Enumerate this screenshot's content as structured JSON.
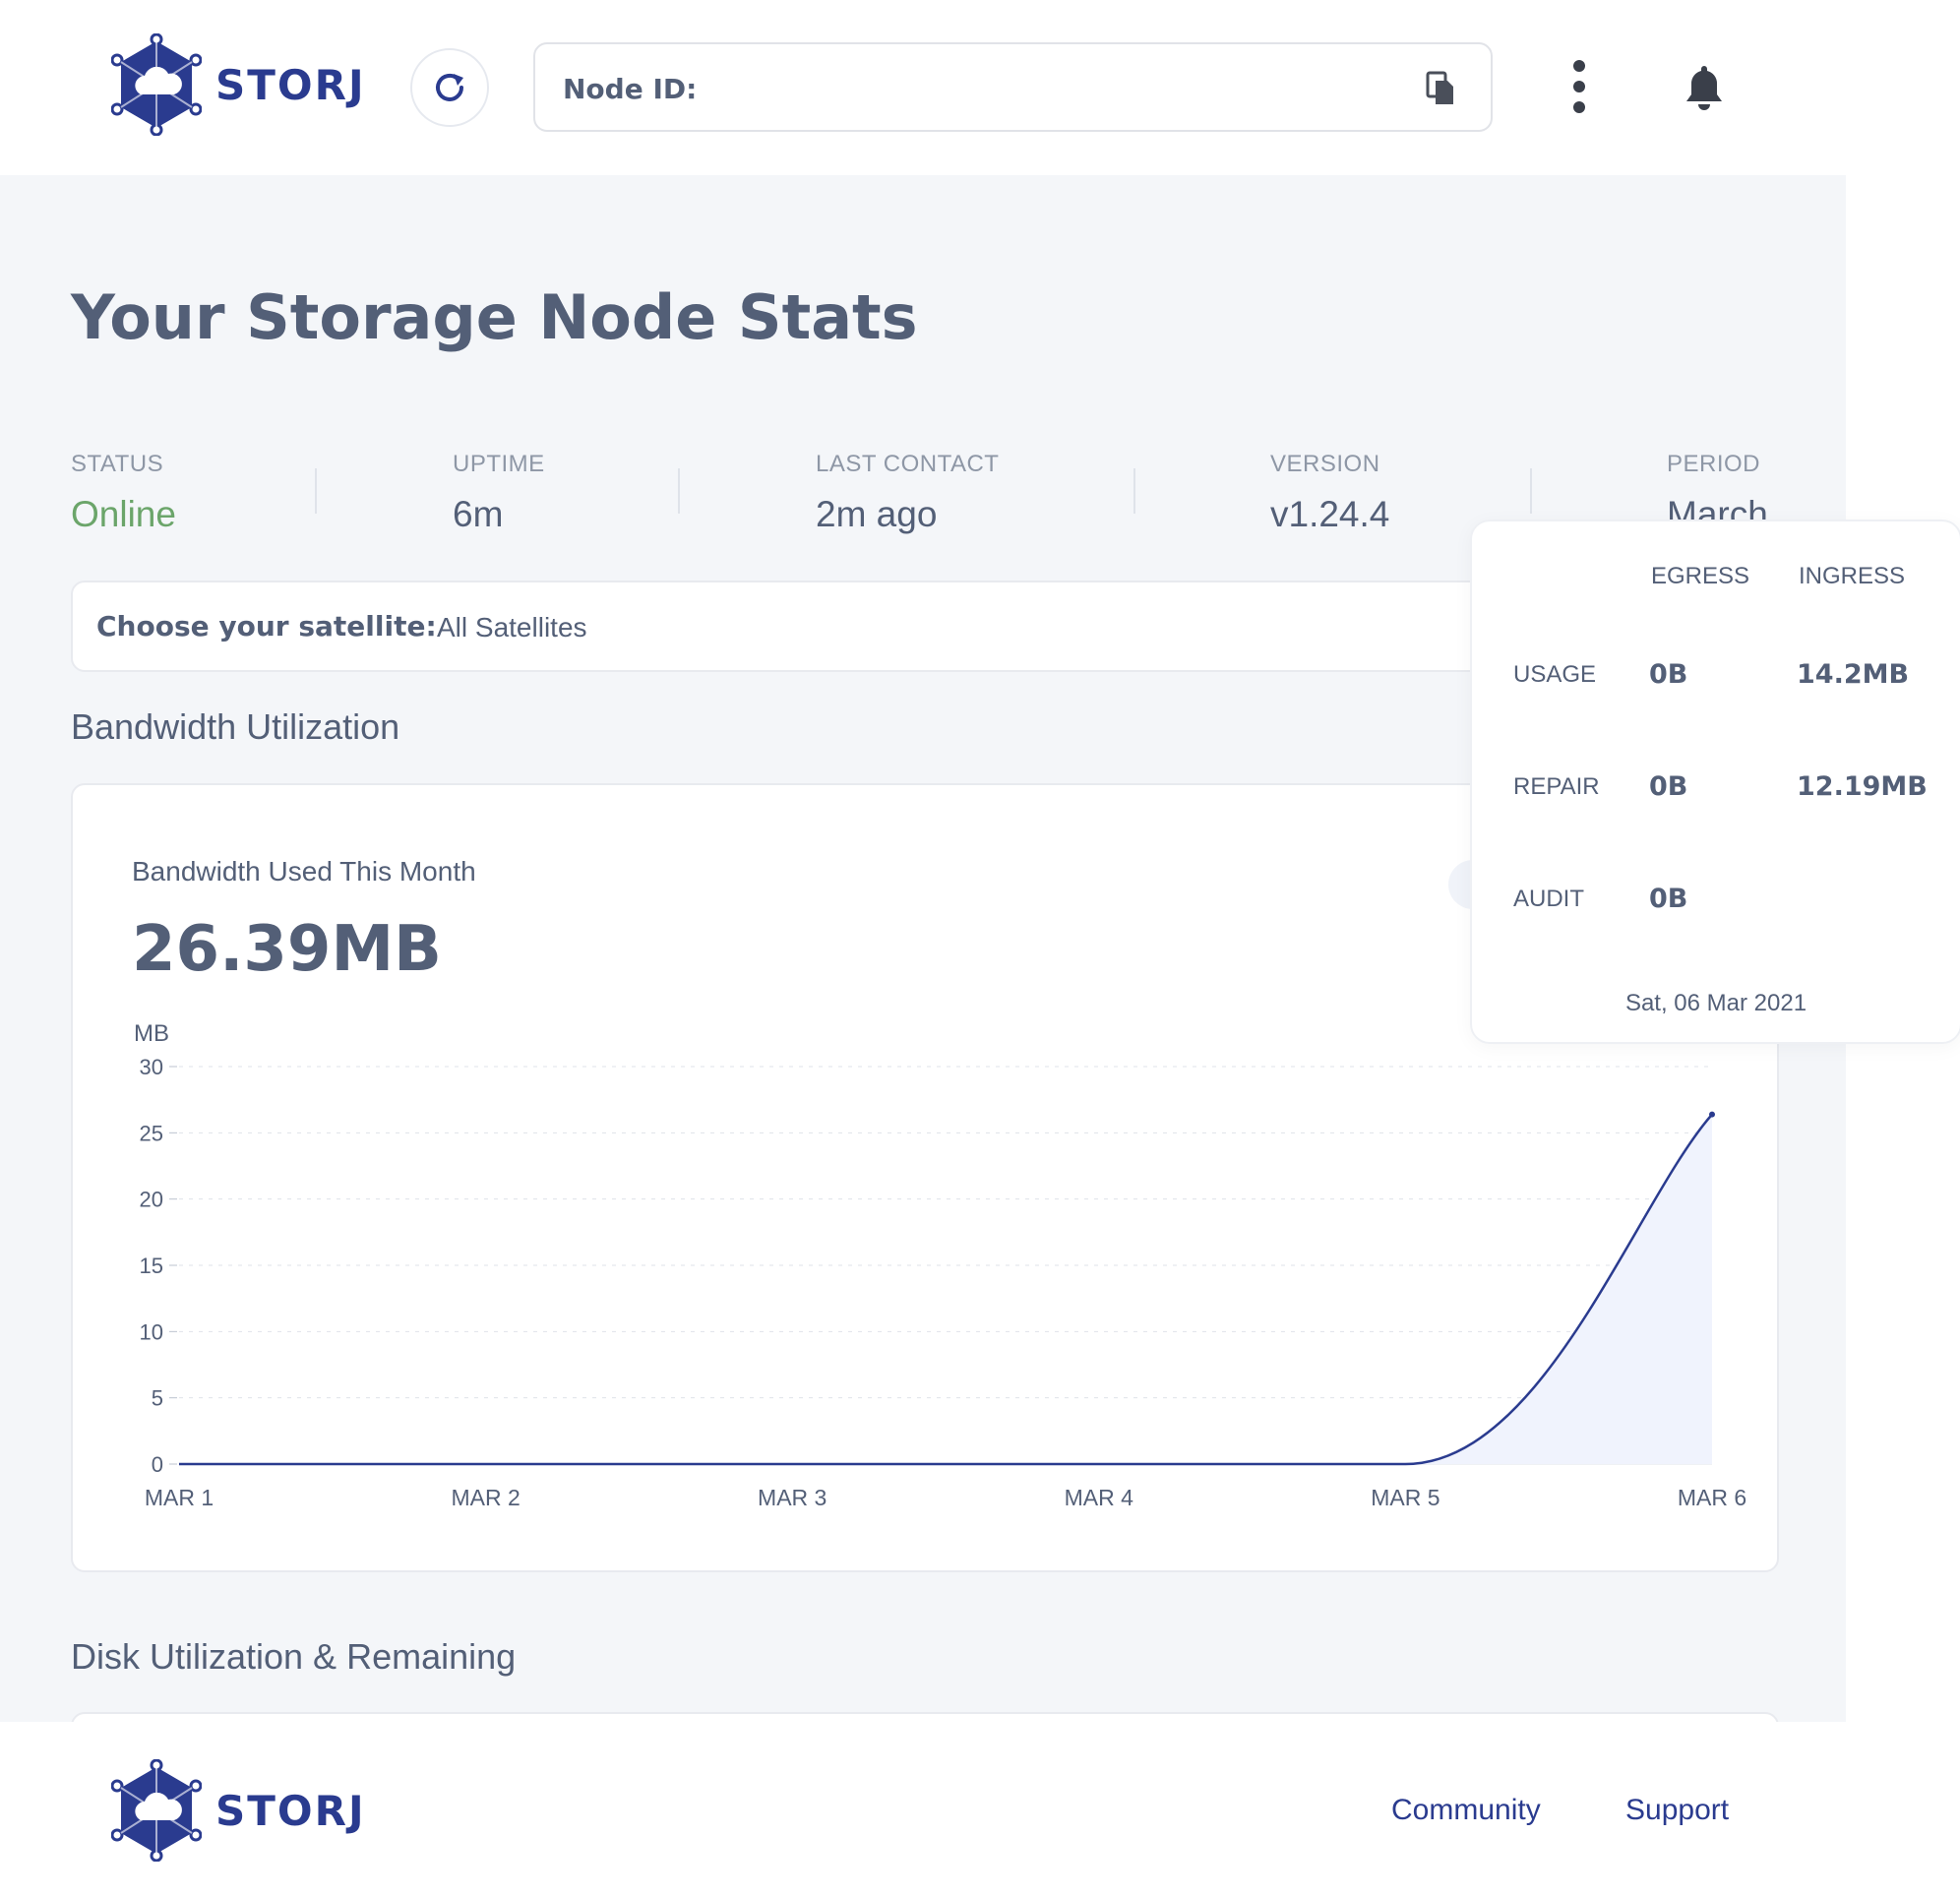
{
  "header": {
    "logo_text": "STORJ",
    "node_id_label": "Node ID:",
    "icons": [
      "refresh-icon",
      "copy-icon",
      "more-vertical-icon",
      "bell-icon"
    ]
  },
  "page": {
    "title": "Your Storage Node Stats"
  },
  "stats": {
    "status": {
      "label": "STATUS",
      "value": "Online",
      "color": "#6ba56a"
    },
    "uptime": {
      "label": "UPTIME",
      "value": "6m"
    },
    "last_contact": {
      "label": "LAST CONTACT",
      "value": "2m ago"
    },
    "version": {
      "label": "VERSION",
      "value": "v1.24.4"
    },
    "period": {
      "label": "PERIOD",
      "value": "March"
    }
  },
  "satellite": {
    "label": "Choose your satellite:",
    "value": "All Satellites"
  },
  "bandwidth": {
    "section_title": "Bandwidth Utilization",
    "card_title": "Bandwidth Used This Month",
    "total": "26.39MB"
  },
  "chart_data": {
    "type": "area",
    "ylabel": "MB",
    "x": [
      "MAR 1",
      "MAR 2",
      "MAR 3",
      "MAR 4",
      "MAR 5",
      "MAR 6"
    ],
    "values": [
      0,
      0,
      0,
      0,
      0,
      26.39
    ],
    "ylim": [
      0,
      30
    ],
    "yticks": [
      0,
      5,
      10,
      15,
      20,
      25,
      30
    ],
    "grid": true,
    "line_color": "#2a3b8f",
    "fill_color": "#f0f3fd"
  },
  "tooltip": {
    "columns": [
      "EGRESS",
      "INGRESS"
    ],
    "rows": [
      {
        "label": "USAGE",
        "egress": "0B",
        "ingress": "14.2MB"
      },
      {
        "label": "REPAIR",
        "egress": "0B",
        "ingress": "12.19MB"
      },
      {
        "label": "AUDIT",
        "egress": "0B",
        "ingress": ""
      }
    ],
    "date": "Sat, 06 Mar 2021"
  },
  "disk": {
    "section_title": "Disk Utilization & Remaining"
  },
  "footer": {
    "logo_text": "STORJ",
    "links": [
      "Community",
      "Support"
    ]
  },
  "colors": {
    "brand": "#2a3b8f",
    "text": "#535f77",
    "online": "#6ba56a",
    "background": "#f4f6f9"
  }
}
